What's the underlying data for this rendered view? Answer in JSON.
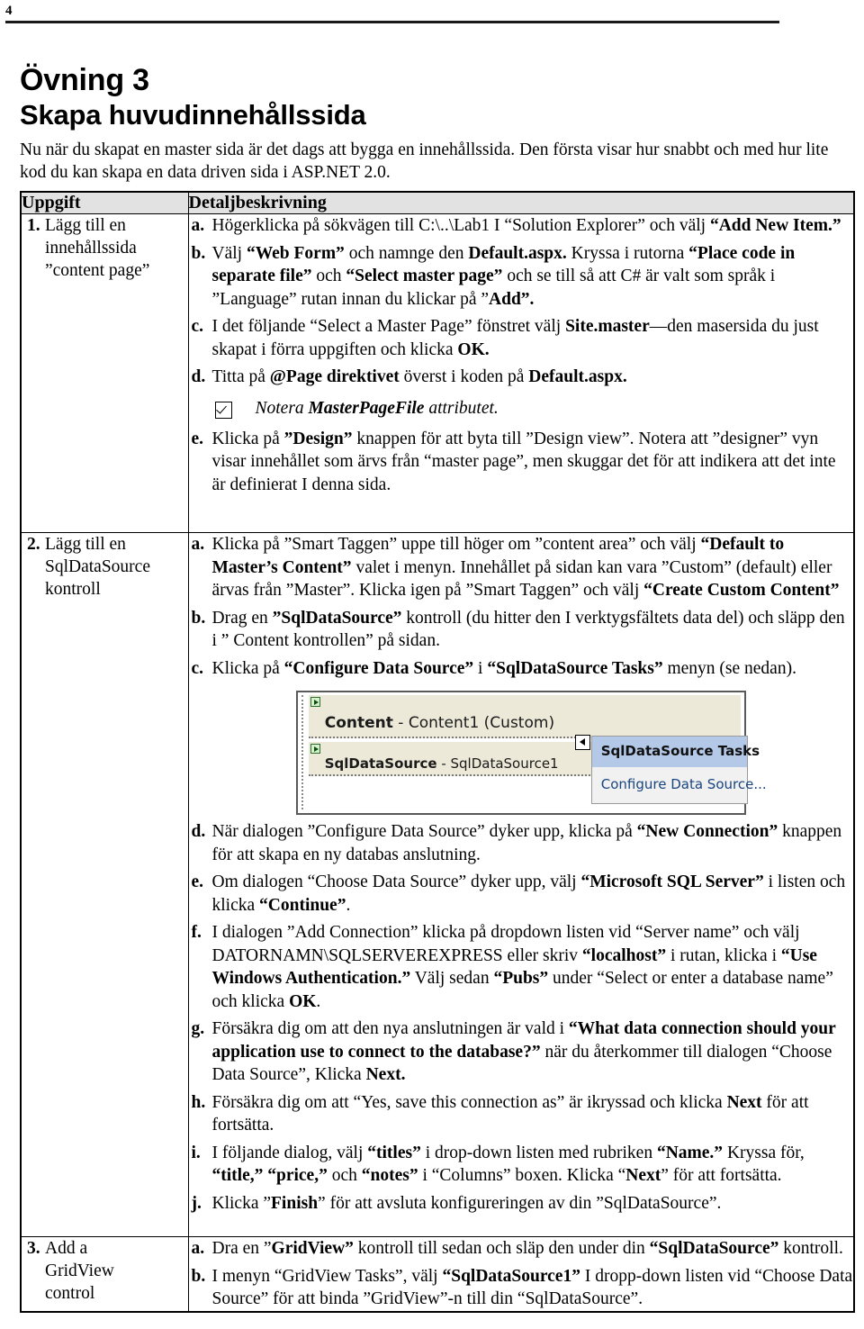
{
  "header": {
    "page_number": "4"
  },
  "doc": {
    "exercise_title": "Övning 3",
    "exercise_subtitle": "Skapa huvudinnehållssida",
    "intro_line1": "Nu när du skapat en master sida är det dags att bygga en innehållssida. Den första visar hur snabbt och",
    "intro_line2": "med hur lite kod du kan skapa en data driven sida i ASP.NET 2.0."
  },
  "table": {
    "headers": {
      "task": "Uppgift",
      "detail": "Detaljbeskrivning"
    },
    "rows": [
      {
        "number": "1.",
        "task_lines": [
          "Lägg till en",
          "innehållssida",
          "”content page”"
        ],
        "steps": [
          {
            "label": "a.",
            "html": "Högerklicka på sökvägen till C:\\..\\Lab1 I “Solution Explorer” och välj <span class=\"b\">“Add New Item.”</span>"
          },
          {
            "label": "b.",
            "html": "Välj <span class=\"b\">“Web Form”</span> och namnge den <span class=\"b\">Default.aspx.</span> Kryssa i rutorna <span class=\"b\">“Place code in separate file”</span> och <span class=\"b\">“Select master page”</span> och se till så att C# är valt som språk i ”Language” rutan innan du klickar på ”<span class=\"b\">Add”.</span>"
          },
          {
            "label": "c.",
            "html": "I det följande “Select a Master Page” fönstret välj <span class=\"b\">Site.master</span>—den masersida du just skapat i förra uppgiften och klicka <span class=\"b\">OK.</span>"
          },
          {
            "label": "d.",
            "html": "Titta på <span class=\"b\">@Page direktivet</span> överst i koden på <span class=\"b\">Default.aspx.</span>"
          }
        ],
        "note": {
          "icon": "checked-checkbox-icon",
          "html": "Notera <span class=\"b\">MasterPageFile</span> attributet."
        },
        "steps_after_note": [
          {
            "label": "e.",
            "html": "Klicka på <span class=\"b\">”Design”</span> knappen för att byta till ”Design view”. Notera att ”designer” vyn visar innehållet som ärvs från “master page”, men skuggar det för att indikera att det inte är definierat I denna sida."
          }
        ]
      },
      {
        "number": "2.",
        "task_lines": [
          "Lägg till en",
          "SqlDataSource",
          "kontroll"
        ],
        "steps": [
          {
            "label": "a.",
            "html": "Klicka på ”Smart Taggen” uppe till höger om ”content area” och välj <span class=\"b\">“Default to Master’s Content”</span> valet i menyn. Innehållet på sidan kan vara ”Custom” (default) eller ärvas från ”Master”. Klicka igen på ”Smart Taggen” och välj <span class=\"b\">“Create Custom Content”</span>"
          },
          {
            "label": "b.",
            "html": "Drag en <span class=\"b\">”SqlDataSource”</span> kontroll (du hitter den I verktygsfältets data del) och släpp den i ” Content kontrollen” på sidan."
          },
          {
            "label": "c.",
            "html": "Klicka på <span class=\"b\">“Configure Data Source”</span> i <span class=\"b\">“SqlDataSource Tasks”</span> menyn (se nedan)."
          }
        ],
        "figure": {
          "name": "vs-designer-screenshot",
          "content_tag_icon": "content-tag-icon",
          "content_label_bold": "Content",
          "content_label_rest": " - Content1 (Custom)",
          "sds_tag_icon": "sqldatasource-tag-icon",
          "sds_label_bold": "SqlDataSource",
          "sds_label_rest": " - SqlDataSource1",
          "smart_tag_icon": "smart-tag-arrow-icon",
          "menu_title": "SqlDataSource Tasks",
          "menu_item": "Configure Data Source...",
          "colors": {
            "band": "#ece9d8",
            "menu_title_bg": "#b4c8e8",
            "menu_link": "#19457f",
            "menu_bg": "#f1f1f1"
          }
        },
        "steps_after_figure": [
          {
            "label": "d.",
            "html": "När dialogen ”Configure Data Source” dyker upp, klicka på <span class=\"b\">“New Connection”</span> knappen för att skapa en ny databas anslutning."
          },
          {
            "label": "e.",
            "html": "Om dialogen “Choose Data Source” dyker upp, välj <span class=\"b\">“Microsoft SQL Server”</span> i listen och klicka <span class=\"b\">“Continue”</span>."
          },
          {
            "label": "f.",
            "html": "I dialogen ”Add Connection” klicka på dropdown listen vid “Server name” och välj DATORNAMN\\SQLSERVEREXPRESS eller skriv <span class=\"b\">“localhost”</span> i rutan, klicka i <span class=\"b\">“Use Windows Authentication.”</span> Välj sedan <span class=\"b\">“Pubs”</span> under “Select or enter a database name” och klicka <span class=\"b\">OK</span>."
          },
          {
            "label": "g.",
            "html": "Försäkra dig om att den nya anslutningen är vald i <span class=\"b\">“What data connection should your application use to connect to the database?”</span> när du återkommer till dialogen “Choose Data Source”, Klicka <span class=\"b\">Next.</span>"
          },
          {
            "label": "h.",
            "html": "Försäkra dig om att “Yes, save this connection as” är ikryssad och klicka <span class=\"b\">Next</span> för att fortsätta."
          },
          {
            "label": "i.",
            "html": "I följande dialog, välj <span class=\"b\">“titles”</span> i drop-down listen med rubriken <span class=\"b\">“Name.”</span> Kryssa för, <span class=\"b\">“title,” “price,”</span> och <span class=\"b\">“notes”</span> i “Columns” boxen. Klicka “<span class=\"b\">Next</span>” för att fortsätta."
          },
          {
            "label": "j.",
            "html": "Klicka ”<span class=\"b\">Finish</span>” för att avsluta konfigureringen av din ”SqlDataSource”."
          }
        ]
      },
      {
        "number": "3.",
        "task_lines": [
          "Add a",
          "GridView",
          "control"
        ],
        "steps": [
          {
            "label": "a.",
            "html": "Dra en ”<span class=\"b\">GridView”</span> kontroll till sedan och släp den under din <span class=\"b\">“SqlDataSource”</span> kontroll."
          },
          {
            "label": "b.",
            "html": "I menyn “GridView Tasks”, välj <span class=\"b\">“SqlDataSource1”</span> I dropp-down listen vid “Choose Data Source” för att binda ”GridView”-n till din “SqlDataSource”."
          }
        ]
      }
    ]
  }
}
